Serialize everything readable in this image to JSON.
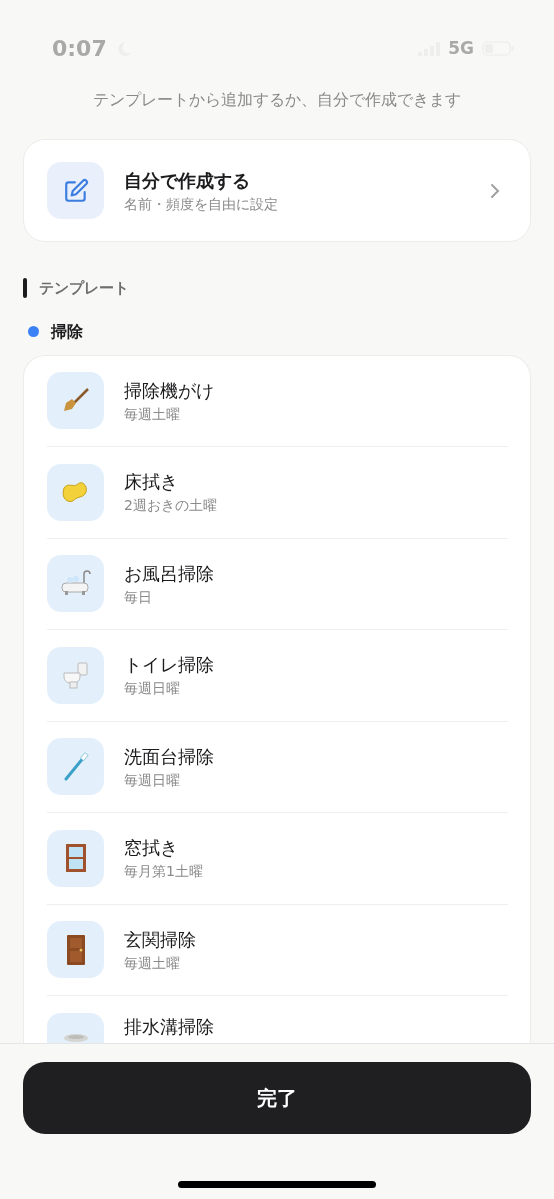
{
  "status_bar": {
    "time": "0:07",
    "network": "5G"
  },
  "intro": "テンプレートから追加するか、自分で作成できます",
  "custom": {
    "title": "自分で作成する",
    "subtitle": "名前・頻度を自由に設定"
  },
  "section_title": "テンプレート",
  "category": {
    "name": "掃除",
    "color": "#3b82f6"
  },
  "templates": [
    {
      "title": "掃除機がけ",
      "schedule": "毎週土曜"
    },
    {
      "title": "床拭き",
      "schedule": "2週おきの土曜"
    },
    {
      "title": "お風呂掃除",
      "schedule": "毎日"
    },
    {
      "title": "トイレ掃除",
      "schedule": "毎週日曜"
    },
    {
      "title": "洗面台掃除",
      "schedule": "毎週日曜"
    },
    {
      "title": "窓拭き",
      "schedule": "毎月第1土曜"
    },
    {
      "title": "玄関掃除",
      "schedule": "毎週土曜"
    },
    {
      "title": "排水溝掃除"
    }
  ],
  "done_button": "完了"
}
